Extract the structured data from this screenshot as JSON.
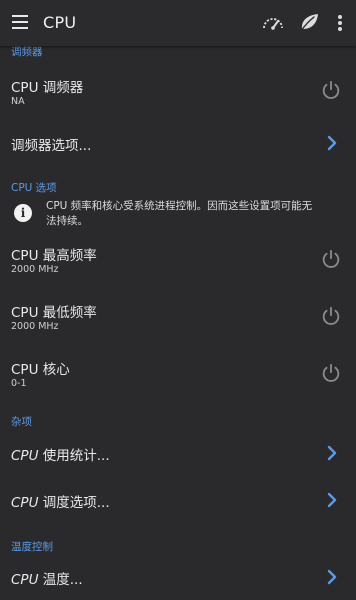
{
  "appbar": {
    "title": "CPU",
    "menu_icon": "hamburger-menu-icon",
    "actions": [
      "speedometer-icon",
      "leaf-icon",
      "more-vert-icon"
    ]
  },
  "sections": {
    "governor": {
      "header": "调频器",
      "cpu_governor": {
        "title": "CPU 调频器",
        "value": "NA"
      },
      "governor_options": {
        "title": "调频器选项..."
      }
    },
    "cpu_options": {
      "header": "CPU 选项",
      "info": "CPU 频率和核心受系统进程控制。因而这些设置项可能无法持续。",
      "max_freq": {
        "title": "CPU 最高频率",
        "value": "2000 MHz"
      },
      "min_freq": {
        "title": "CPU 最低频率",
        "value": "2000 MHz"
      },
      "cores": {
        "title": "CPU 核心",
        "value": "0-1"
      }
    },
    "misc": {
      "header": "杂项",
      "usage_stats": {
        "title_prefix": "CPU",
        "title_suffix": " 使用统计..."
      },
      "scheduler": {
        "title_prefix": "CPU",
        "title_suffix": " 调度选项..."
      }
    },
    "thermal": {
      "header": "温度控制",
      "temperature": {
        "title_prefix": "CPU",
        "title_suffix": " 温度..."
      }
    }
  },
  "colors": {
    "background": "#2a2a2d",
    "accent": "#5b9ae8",
    "icon_gray": "#8a8a8a"
  }
}
